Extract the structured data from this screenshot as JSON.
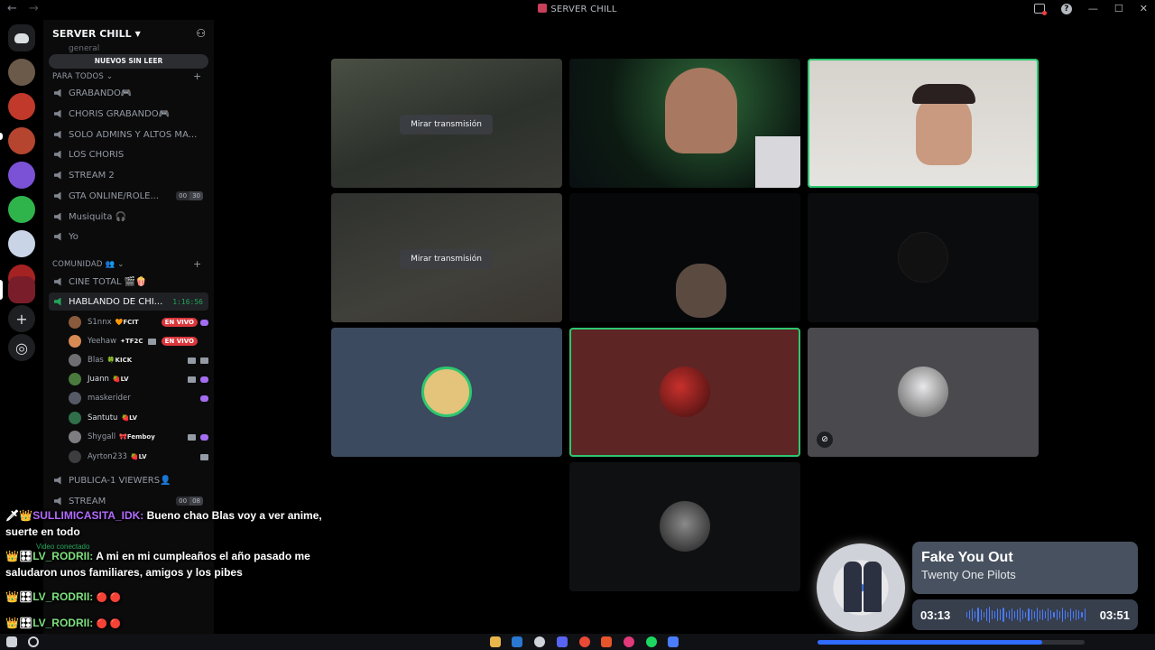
{
  "window": {
    "title": "SERVER CHILL"
  },
  "server": {
    "name": "SERVER CHILL",
    "unread_pill": "NUEVOS SIN LEER",
    "ghost_channel": "general"
  },
  "categories": [
    {
      "name": "PARA TODOS",
      "plus": "+"
    },
    {
      "name": "COMUNIDAD",
      "plus": "+"
    }
  ],
  "channels": [
    {
      "name": "GRABANDO🎮"
    },
    {
      "name": "CHORIS GRABANDO🎮"
    },
    {
      "name": "SOLO ADMINS Y ALTOS MA..."
    },
    {
      "name": "LOS CHORIS"
    },
    {
      "name": "STREAM 2"
    },
    {
      "name": "GTA ONLINE/ROLE...",
      "count_a": "00",
      "count_b": "30"
    },
    {
      "name": "Musiquita 🎧"
    },
    {
      "name": "Yo"
    },
    {
      "name": "CINE TOTAL 🎬🍿"
    },
    {
      "name": "HABLANDO DE CHI...",
      "timer": "1:16:56"
    },
    {
      "name": "PUBLICA-1 VIEWERS👤"
    },
    {
      "name": "STREAM",
      "count_a": "00",
      "count_b": "08"
    }
  ],
  "voice_users": [
    {
      "name": "S1nnx",
      "tag": "🧡FCIT",
      "live": "EN VIVO",
      "color": "#8a5a3c"
    },
    {
      "name": "Yeehaw",
      "tag": "✦TF2C",
      "live": "EN VIVO",
      "color": "#d88a54"
    },
    {
      "name": "Blas",
      "tag": "🍀KICK",
      "color": "#6f6f73"
    },
    {
      "name": "Juann",
      "tag": "🍓LV",
      "color": "#4a7a3e"
    },
    {
      "name": "maskerider",
      "tag": "",
      "color": "#555a66"
    },
    {
      "name": "Santutu",
      "tag": "🍓LV",
      "color": "#2f6f4a"
    },
    {
      "name": "Shygall",
      "tag": "🎀Femboy",
      "color": "#7d7d82"
    },
    {
      "name": "Ayrton233",
      "tag": "🍓LV",
      "color": "#3d3d40"
    }
  ],
  "stage": {
    "watch_stream_label": "Mirar transmisión"
  },
  "chat": [
    {
      "user": "SULLIMICASITA_IDK:",
      "text": "Bueno chao Blas voy a ver anime, suerte en todo",
      "style": "u1"
    },
    {
      "user": "LV_RODRII:",
      "text": "A mi en mi cumpleaños el año pasado me saludaron unos familiares, amigos y los pibes",
      "style": "u2"
    },
    {
      "user": "LV_RODRII:",
      "text": "",
      "style": "u2"
    },
    {
      "user": "LV_RODRII:",
      "text": "",
      "style": "u2"
    }
  ],
  "voice_status": "Video conectado",
  "now_playing": {
    "title": "Fake You Out",
    "artist": "Twenty One Pilots",
    "elapsed": "03:13",
    "duration": "03:51",
    "progress_fraction": 0.84
  },
  "colors": {
    "speaking": "#2dc770",
    "live": "#da373c",
    "brand": "#5865f2",
    "spotify_accent": "#4a7dff"
  }
}
